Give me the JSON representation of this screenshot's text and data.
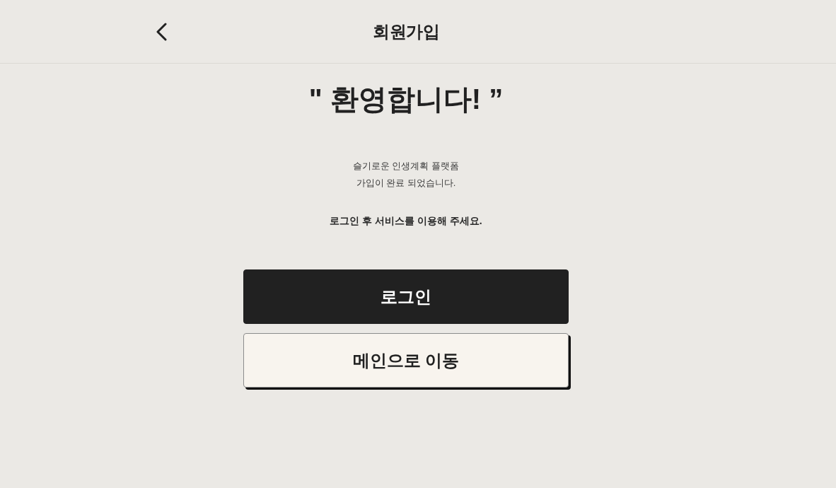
{
  "header": {
    "title": "회원가입"
  },
  "welcome": {
    "heading": "\" 환영합니다! ”",
    "message_lines": [
      "슬기로운 인생계획 플랫폼",
      "가입이 완료 되었습니다."
    ],
    "notice": "로그인 후 서비스를 이용해 주세요."
  },
  "buttons": [
    {
      "label": "로그인",
      "kind": "primary"
    },
    {
      "label": "메인으로 이동",
      "kind": "secondary"
    }
  ]
}
